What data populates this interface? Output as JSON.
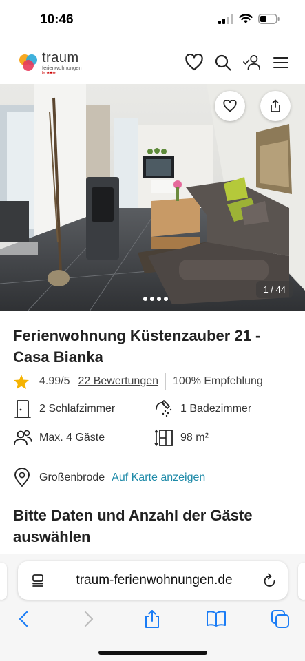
{
  "status": {
    "time": "10:46"
  },
  "header": {
    "logo_main": "traum",
    "logo_sub": "ferienwohnungen",
    "logo_by": "by ◉◉◉"
  },
  "gallery": {
    "counter": "1 / 44",
    "dot_count": 4
  },
  "listing": {
    "title": "Ferienwohnung Küstenzauber 21 - Casa Bianka",
    "rating": "4.99/5",
    "reviews": "22 Bewertungen",
    "recommendation": "100% Empfehlung",
    "bedrooms": "2 Schlafzimmer",
    "bathrooms": "1 Badezimmer",
    "guests": "Max. 4 Gäste",
    "size": "98 m²",
    "location": "Großenbrode",
    "map_link": "Auf Karte anzeigen",
    "booking_heading": "Bitte Daten und Anzahl der Gäste auswählen"
  },
  "browser": {
    "url": "traum-ferienwohnungen.de"
  },
  "colors": {
    "accent": "#1e8aa8",
    "star": "#f5b301"
  }
}
